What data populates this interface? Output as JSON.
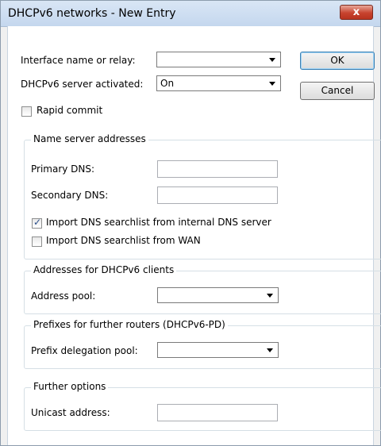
{
  "window": {
    "title": "DHCPv6 networks - New Entry",
    "close_glyph": "x"
  },
  "fields": {
    "interface_label": "Interface name or relay:",
    "interface_value": "",
    "server_activated_label": "DHCPv6 server activated:",
    "server_activated_value": "On",
    "rapid_commit_label": "Rapid commit",
    "rapid_commit_checked": false
  },
  "buttons": {
    "ok": "OK",
    "cancel": "Cancel"
  },
  "name_server": {
    "legend": "Name server addresses",
    "primary_label": "Primary DNS:",
    "primary_value": "",
    "secondary_label": "Secondary DNS:",
    "secondary_value": "",
    "import_internal_label": "Import DNS searchlist from internal DNS server",
    "import_internal_checked": true,
    "import_wan_label": "Import DNS searchlist from WAN",
    "import_wan_checked": false
  },
  "clients": {
    "legend": "Addresses for DHCPv6 clients",
    "pool_label": "Address pool:",
    "pool_value": ""
  },
  "prefixes": {
    "legend": "Prefixes for further routers (DHCPv6-PD)",
    "pool_label": "Prefix delegation pool:",
    "pool_value": ""
  },
  "further": {
    "legend": "Further options",
    "unicast_label": "Unicast address:",
    "unicast_value": ""
  },
  "glyphs": {
    "check": "✓"
  }
}
